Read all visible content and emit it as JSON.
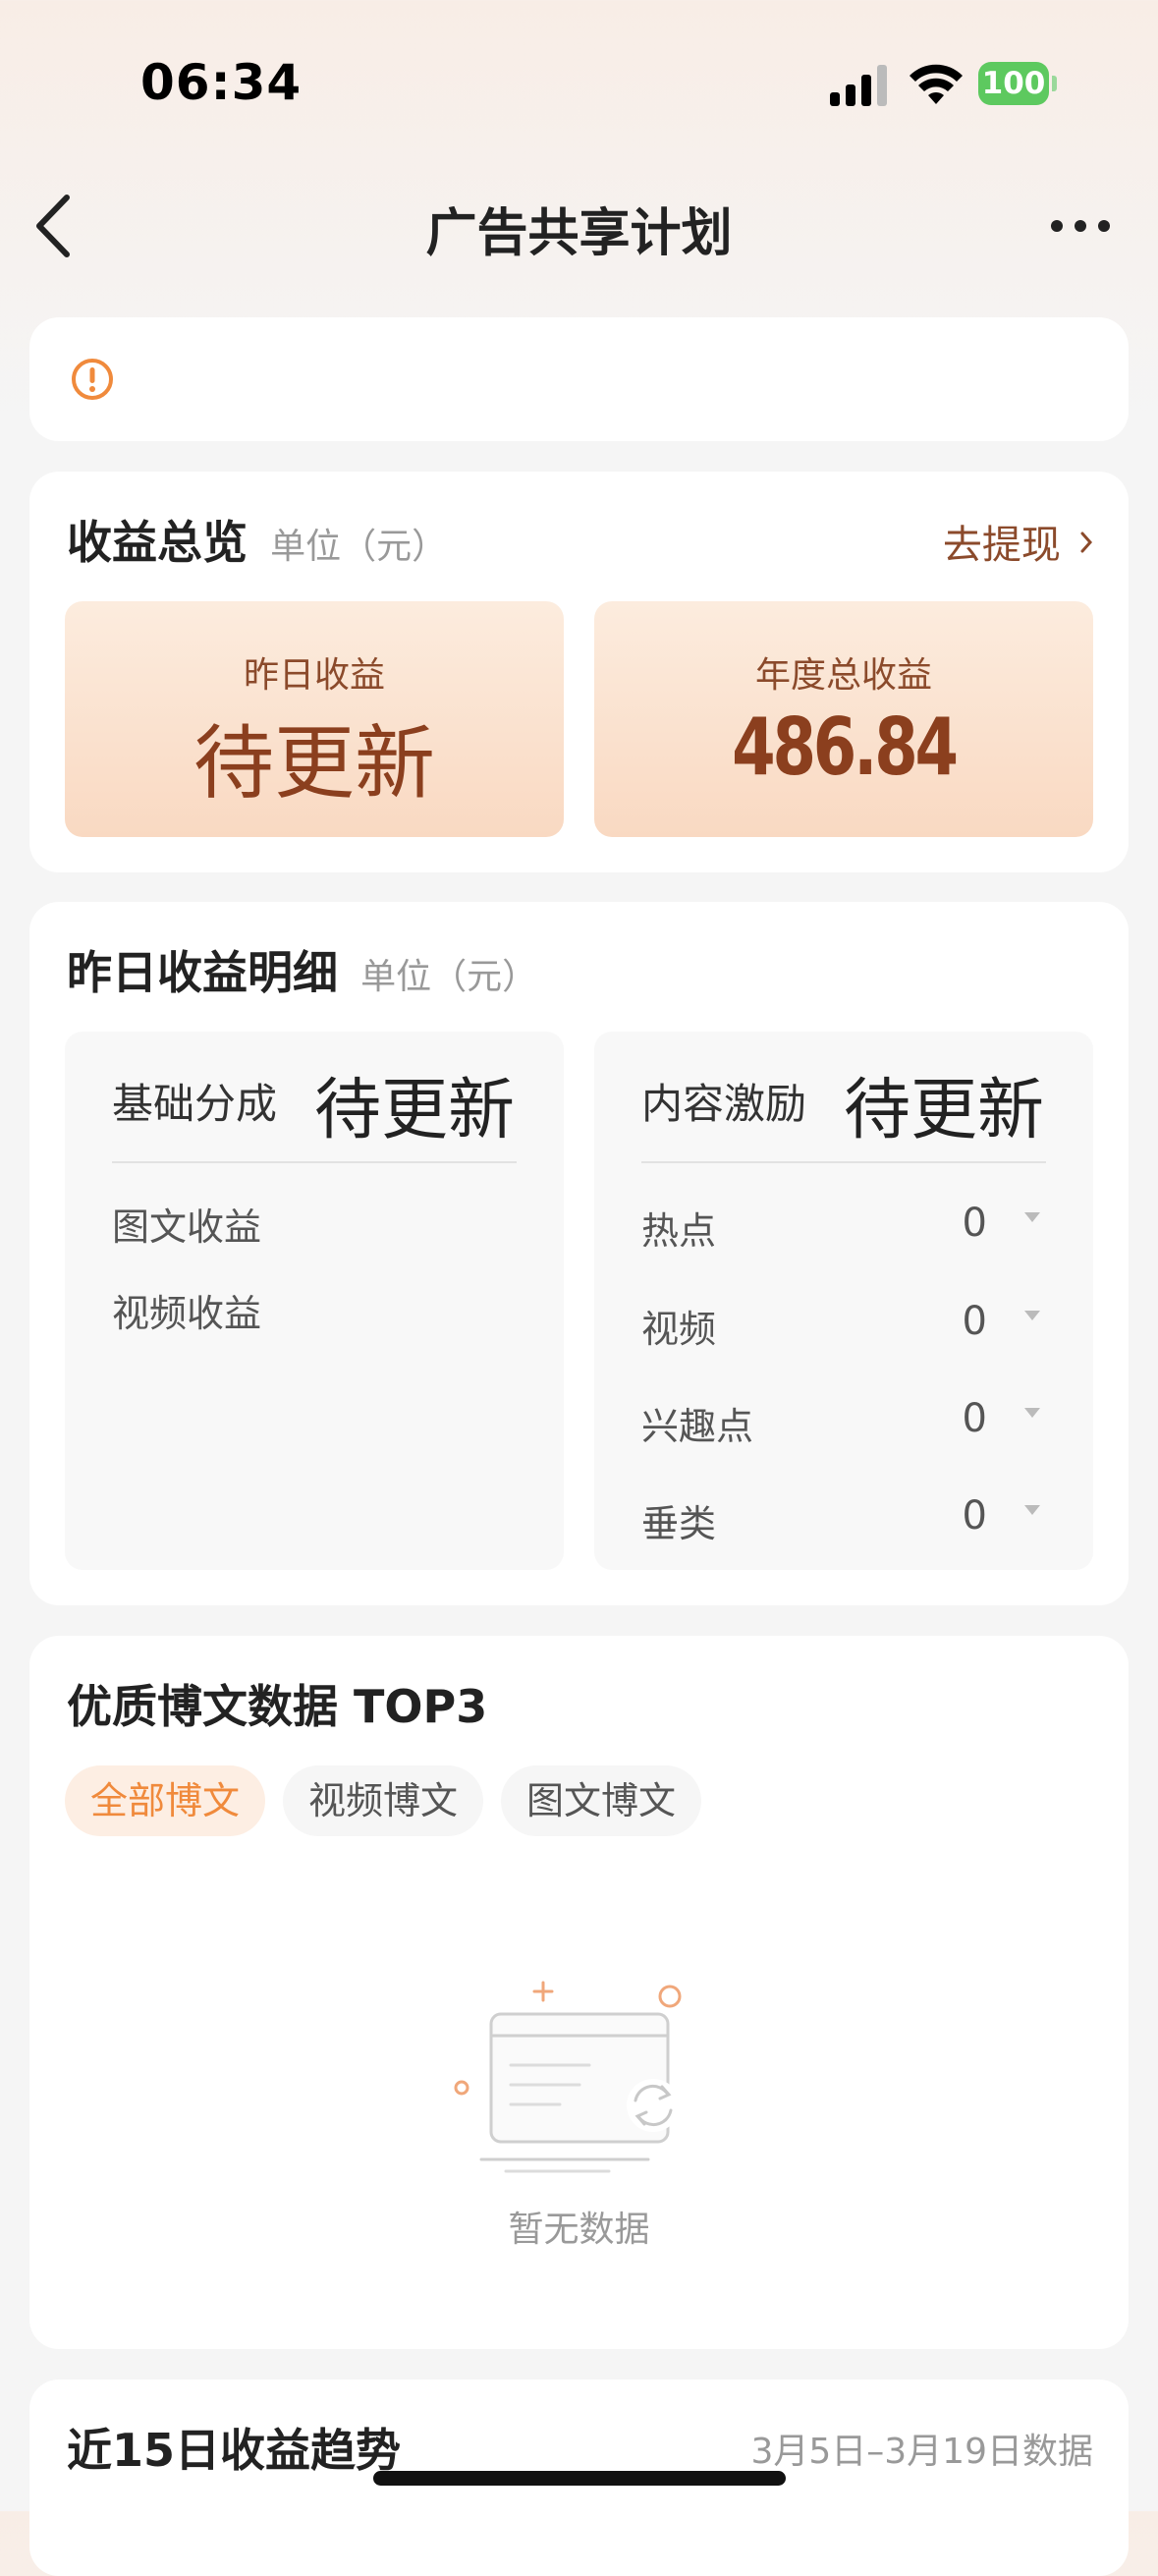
{
  "status": {
    "time": "06:34",
    "battery": "100"
  },
  "nav": {
    "title": "广告共享计划"
  },
  "overview": {
    "title": "收益总览",
    "unit": "单位（元）",
    "withdraw": "去提现",
    "yesterday_label": "昨日收益",
    "yesterday_value": "待更新",
    "annual_label": "年度总收益",
    "annual_value": "486.84"
  },
  "detail": {
    "title": "昨日收益明细",
    "unit": "单位（元）",
    "base": {
      "label": "基础分成",
      "value": "待更新",
      "items": [
        "图文收益",
        "视频收益"
      ]
    },
    "incentive": {
      "label": "内容激励",
      "value": "待更新",
      "items": [
        {
          "label": "热点",
          "value": "0"
        },
        {
          "label": "视频",
          "value": "0"
        },
        {
          "label": "兴趣点",
          "value": "0"
        },
        {
          "label": "垂类",
          "value": "0"
        }
      ]
    }
  },
  "top3": {
    "title": "优质博文数据 TOP3",
    "tabs": [
      "全部博文",
      "视频博文",
      "图文博文"
    ],
    "active_tab": "全部博文",
    "empty_text": "暂无数据"
  },
  "trend": {
    "title": "近15日收益趋势",
    "range": "3月5日–3月19日数据"
  },
  "colors": {
    "accent": "#f08a3c",
    "brand_brown": "#8b3f1e",
    "battery": "#5dc95f"
  }
}
